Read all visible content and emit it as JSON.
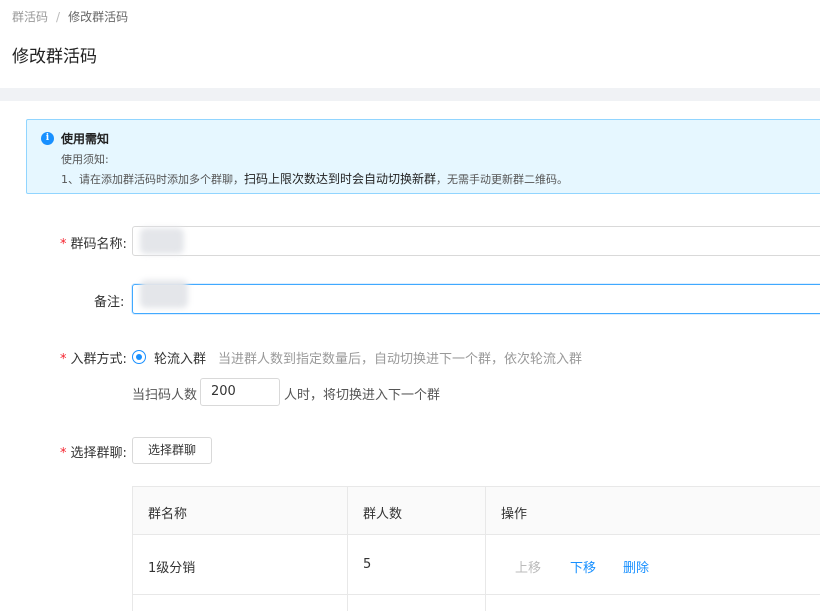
{
  "breadcrumb": {
    "parent": "群活码",
    "separator": "/",
    "current": "修改群活码"
  },
  "page": {
    "title": "修改群活码"
  },
  "notice": {
    "title": "使用需知",
    "line1": "使用须知:",
    "line2_prefix": "1、请在添加群活码时添加多个群聊，",
    "line2_highlight": "扫码上限次数达到时会自动切换新群",
    "line2_suffix": "，无需手动更新群二维码。"
  },
  "form": {
    "name": {
      "label": "群码名称:",
      "value": ""
    },
    "remark": {
      "label": "备注:",
      "value": ""
    },
    "join_mode": {
      "label": "入群方式:",
      "option_label": "轮流入群",
      "option_desc": "当进群人数到指定数量后，自动切换进下一个群，依次轮流入群",
      "scan_prefix": "当扫码人数",
      "scan_value": "200",
      "scan_suffix": "人时，将切换进入下一个群"
    },
    "group_select": {
      "label": "选择群聊:",
      "button_label": "选择群聊"
    }
  },
  "table": {
    "headers": [
      "群名称",
      "群人数",
      "操作"
    ],
    "rows": [
      {
        "name": "1级分销",
        "count": "5",
        "actions": {
          "up": "上移",
          "down": "下移",
          "delete": "删除"
        }
      }
    ]
  },
  "colors": {
    "primary": "#1890ff",
    "required": "#f5222d",
    "notice_bg": "#e6f7ff",
    "notice_border": "#91d5ff"
  }
}
